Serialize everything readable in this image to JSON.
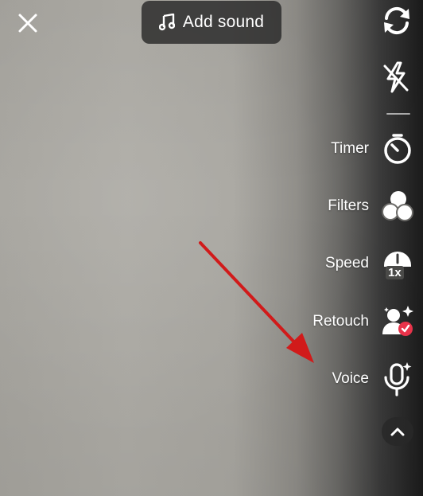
{
  "topbar": {
    "close_icon": "close-icon",
    "add_sound_label": "Add sound",
    "add_sound_icon": "music-note-icon",
    "flip_icon": "flip-camera-icon",
    "flash_icon": "flash-off-icon"
  },
  "tools": [
    {
      "label": "Timer",
      "icon": "timer-icon"
    },
    {
      "label": "Filters",
      "icon": "filters-icon"
    },
    {
      "label": "Speed",
      "icon": "speed-icon",
      "badge": "1x"
    },
    {
      "label": "Retouch",
      "icon": "retouch-icon"
    },
    {
      "label": "Voice",
      "icon": "voice-icon"
    }
  ],
  "expand_icon": "chevron-up-icon",
  "colors": {
    "annotation_arrow": "#d11a1a",
    "retouch_badge": "#e8334a",
    "button_bg": "#282828"
  }
}
